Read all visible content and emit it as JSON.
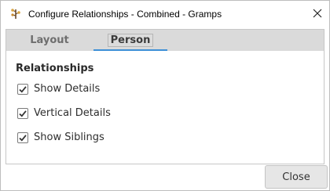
{
  "window": {
    "title": "Configure Relationships - Combined - Gramps",
    "app_icon": "gramps-tree-icon",
    "close_icon": "close-icon"
  },
  "tabs": [
    {
      "label": "Layout",
      "active": false
    },
    {
      "label": "Person",
      "active": true
    }
  ],
  "section": {
    "title": "Relationships",
    "options": [
      {
        "label": "Show Details",
        "checked": true
      },
      {
        "label": "Vertical Details",
        "checked": true
      },
      {
        "label": "Show Siblings",
        "checked": true
      }
    ]
  },
  "footer": {
    "close_label": "Close"
  },
  "colors": {
    "accent": "#3d8fd6",
    "tabstrip_bg": "#dadada",
    "button_bg": "#e6e6e6"
  }
}
